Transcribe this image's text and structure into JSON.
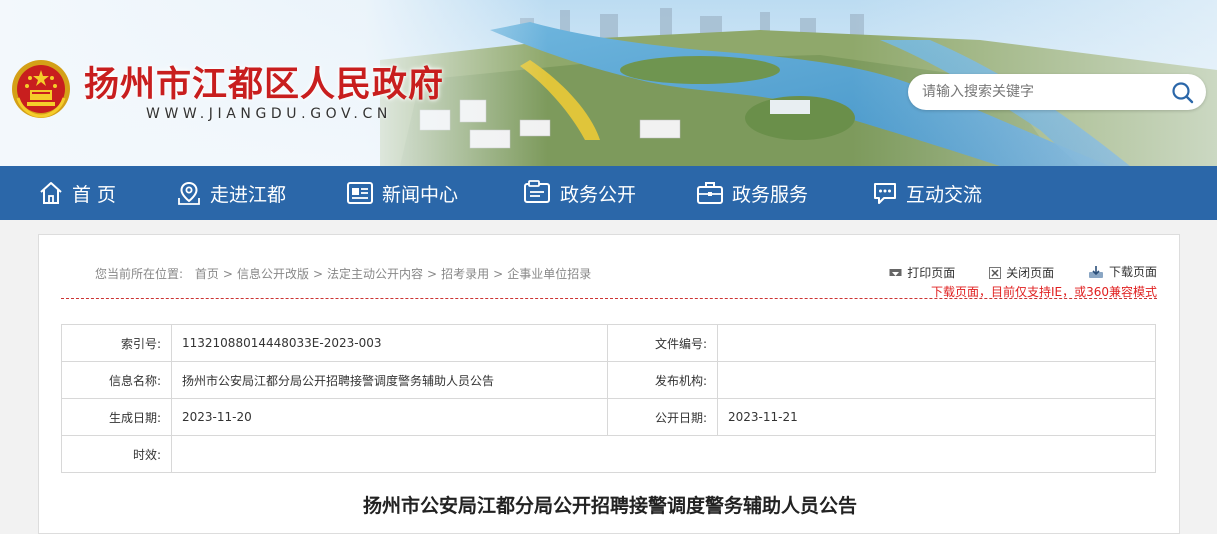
{
  "site": {
    "title": "扬州市江都区人民政府",
    "domain": "WWW.JIANGDU.GOV.CN"
  },
  "search": {
    "placeholder": "请输入搜索关键字"
  },
  "nav": {
    "items": [
      {
        "label": "首 页",
        "icon": "home-icon"
      },
      {
        "label": "走进江都",
        "icon": "location-icon"
      },
      {
        "label": "新闻中心",
        "icon": "news-icon"
      },
      {
        "label": "政务公开",
        "icon": "folder-icon"
      },
      {
        "label": "政务服务",
        "icon": "briefcase-icon"
      },
      {
        "label": "互动交流",
        "icon": "chat-icon"
      }
    ]
  },
  "breadcrumb": {
    "prefix": "您当前所在位置:",
    "items": [
      "首页",
      "信息公开改版",
      "法定主动公开内容",
      "招考录用",
      "企事业单位招录"
    ]
  },
  "tools": {
    "print": "打印页面",
    "close": "关闭页面",
    "download": "下载页面",
    "note": "下载页面，目前仅支持IE，或360兼容模式"
  },
  "meta": {
    "index_label": "索引号:",
    "index_value": "11321088014448033E-2023-003",
    "doc_no_label": "文件编号:",
    "doc_no_value": "",
    "name_label": "信息名称:",
    "name_value": "扬州市公安局江都分局公开招聘接警调度警务辅助人员公告",
    "org_label": "发布机构:",
    "org_value": "",
    "created_label": "生成日期:",
    "created_value": "2023-11-20",
    "published_label": "公开日期:",
    "published_value": "2023-11-21",
    "validity_label": "时效:",
    "validity_value": ""
  },
  "article": {
    "title": "扬州市公安局江都分局公开招聘接警调度警务辅助人员公告"
  },
  "colors": {
    "nav_bg": "#2b67a9",
    "title_red": "#c81e1e",
    "note_red": "#e02020"
  }
}
